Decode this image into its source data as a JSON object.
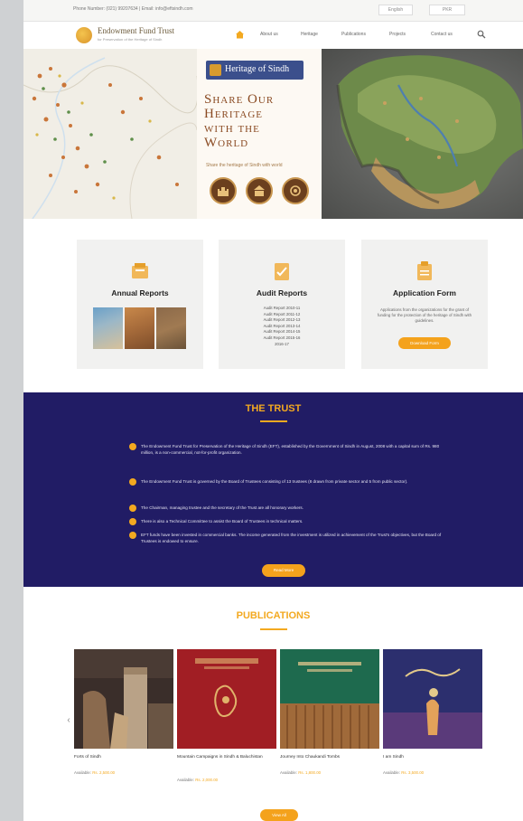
{
  "topbar": {
    "contact": "Phone Number: (021) 99207634 | Email: info@eftsindh.com",
    "language": "English",
    "currency": "PKR"
  },
  "header": {
    "logo_title": "Endowment Fund Trust",
    "logo_subtitle": "for Preservation of the Heritage of Sindh",
    "nav": [
      "About us",
      "Heritage",
      "Publications",
      "Projects",
      "Contact us"
    ]
  },
  "hero": {
    "badge": "Heritage of Sindh",
    "heading": [
      "Share Our",
      "Heritage",
      "with the",
      "World"
    ],
    "subheading": "Share the heritage of Sindh with world"
  },
  "cards": [
    {
      "title": "Annual Reports"
    },
    {
      "title": "Audit Reports",
      "items": [
        "Audit Report 2010-11",
        "Audit Report 2011-12",
        "Audit Report 2012-13",
        "Audit Report 2013-14",
        "Audit Report 2014-15",
        "Audit Report 2015-16",
        "2016-17"
      ]
    },
    {
      "title": "Application Form",
      "description": "Applications from the organizations for the grant of funding for the protection of the heritage of Sindh with guidelines.",
      "button": "Download Form"
    }
  ],
  "trust": {
    "title": "THE TRUST",
    "items": [
      "The Endowment Fund Trust for Preservation of the Heritage of Sindh (EFT), established by the Government of Sindh in August, 2008 with a capital sum of Rs. 980 million, is a non-commercial, not-for-profit organization.",
      "The Endowment Fund Trust is governed by the Board of Trustees consisting of 13 trustees (8 drawn from private sector and 5 from public sector).",
      "The Chairman, managing trustee and the secretary of the Trust are all honorary workers.",
      "There is also a Technical Committee to assist the Board of Trustees in technical matters.",
      "EFT funds have been invested in commercial banks. The income generated from the investment is utilized in achievement of the Trust's objectives, but the Board of Trustees is endowed to ensure."
    ],
    "button": "Read More"
  },
  "publications": {
    "title": "PUBLICATIONS",
    "books": [
      {
        "title": "Forts of Sindh",
        "price_label": "Available:",
        "price": "Rs. 2,500.00"
      },
      {
        "title": "Mountain Campaigns in Sindh & Baluchistan",
        "price_label": "Available:",
        "price": "Rs. 2,000.00"
      },
      {
        "title": "Journey Into Chaukandi Tombs",
        "price_label": "Available:",
        "price": "Rs. 1,800.00"
      },
      {
        "title": "I am Sindh",
        "price_label": "Available:",
        "price": "Rs. 3,500.00"
      }
    ],
    "button": "View All"
  },
  "colors": {
    "accent": "#f3a920",
    "trust_bg": "#211c65",
    "badge_bg": "#3b4f8c",
    "heading": "#8a4a22"
  }
}
